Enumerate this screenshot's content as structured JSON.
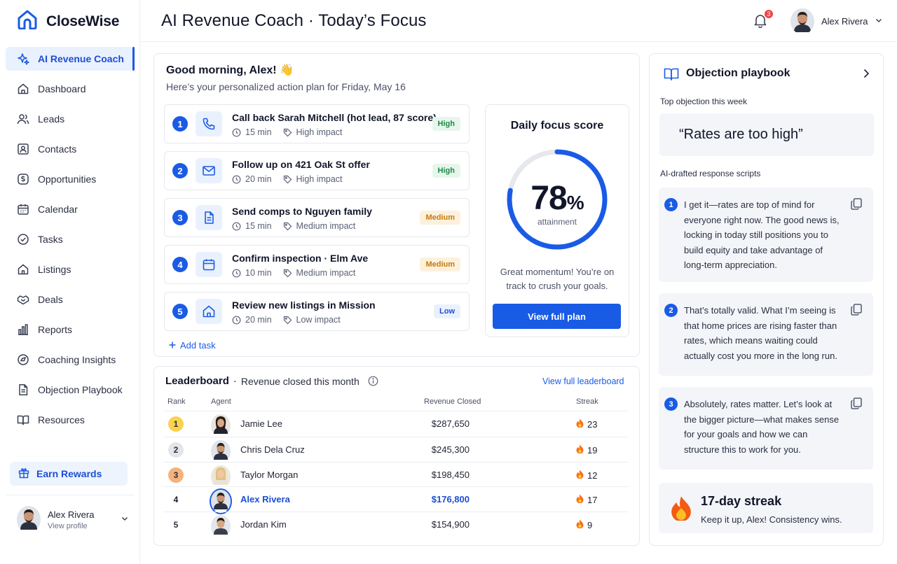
{
  "brand": {
    "name": "CloseWise"
  },
  "sidebar": {
    "items": [
      {
        "label": "AI Revenue Coach",
        "icon": "sparkles-icon"
      },
      {
        "label": "Dashboard",
        "icon": "home-icon"
      },
      {
        "label": "Leads",
        "icon": "users-icon"
      },
      {
        "label": "Contacts",
        "icon": "contact-card-icon"
      },
      {
        "label": "Opportunities",
        "icon": "dollar-icon"
      },
      {
        "label": "Calendar",
        "icon": "calendar-icon"
      },
      {
        "label": "Tasks",
        "icon": "check-circle-icon"
      },
      {
        "label": "Listings",
        "icon": "house-icon"
      },
      {
        "label": "Deals",
        "icon": "handshake-icon"
      },
      {
        "label": "Reports",
        "icon": "bar-chart-icon"
      },
      {
        "label": "Coaching Insights",
        "icon": "compass-icon"
      },
      {
        "label": "Objection Playbook",
        "icon": "document-icon"
      },
      {
        "label": "Resources",
        "icon": "book-icon"
      }
    ],
    "rewards_label": "Earn Rewards",
    "user": {
      "name": "Alex Rivera",
      "sub": "View profile"
    }
  },
  "header": {
    "title": "AI Revenue Coach · Today’s Focus",
    "notification_count": "3",
    "user_name": "Alex Rivera"
  },
  "plan": {
    "greeting": "Good morning, Alex! 👋",
    "subtitle": "Here’s your personalized action plan for Friday, May 16",
    "tasks": [
      {
        "num": "1",
        "title": "Call back Sarah Mitchell (hot lead, 87 score)",
        "time": "15 min",
        "impact": "High impact",
        "priority": "High",
        "icon": "phone-icon"
      },
      {
        "num": "2",
        "title": "Follow up on 421 Oak St offer",
        "time": "20 min",
        "impact": "High impact",
        "priority": "High",
        "icon": "mail-icon"
      },
      {
        "num": "3",
        "title": "Send comps to Nguyen family",
        "time": "15 min",
        "impact": "Medium impact",
        "priority": "Medium",
        "icon": "document-icon"
      },
      {
        "num": "4",
        "title": "Confirm inspection · Elm Ave",
        "time": "10 min",
        "impact": "Medium impact",
        "priority": "Medium",
        "icon": "calendar-icon"
      },
      {
        "num": "5",
        "title": "Review new listings in Mission",
        "time": "20 min",
        "impact": "Low impact",
        "priority": "Low",
        "icon": "house-icon"
      }
    ],
    "add_task": "Add task"
  },
  "focus": {
    "title": "Daily focus score",
    "score": 78,
    "score_text": "78",
    "unit": "%",
    "label": "attainment",
    "message": "Great momentum! You’re on track to crush your goals.",
    "button": "View full plan"
  },
  "leaderboard": {
    "title": "Leaderboard",
    "subtitle": "Revenue closed this month",
    "link": "View full leaderboard",
    "columns": [
      "Rank",
      "Agent",
      "Revenue Closed",
      "Streak"
    ],
    "rows": [
      {
        "rank": "1",
        "agent": "Jamie Lee",
        "revenue": "$287,650",
        "streak": "23"
      },
      {
        "rank": "2",
        "agent": "Chris Dela Cruz",
        "revenue": "$245,300",
        "streak": "19"
      },
      {
        "rank": "3",
        "agent": "Taylor Morgan",
        "revenue": "$198,450",
        "streak": "12"
      },
      {
        "rank": "4",
        "agent": "Alex Rivera",
        "revenue": "$176,800",
        "streak": "17"
      },
      {
        "rank": "5",
        "agent": "Jordan Kim",
        "revenue": "$154,900",
        "streak": "9"
      }
    ]
  },
  "objections": {
    "title": "Objection playbook",
    "top_label": "Top objection this week",
    "quote": "“Rates are too high”",
    "scripts_label": "AI-drafted response scripts",
    "scripts": [
      {
        "num": "1",
        "text": "I get it—rates are top of mind for everyone right now. The good news is, locking in today still positions you to build equity and take advantage of long-term appreciation."
      },
      {
        "num": "2",
        "text": "That’s totally valid. What I’m seeing is that home prices are rising faster than rates, which means waiting could actually cost you more in the long run."
      },
      {
        "num": "3",
        "text": "Absolutely, rates matter. Let’s look at the bigger picture—what makes sense for your goals and how we can structure this to work for you."
      }
    ],
    "streak_title": "17-day streak",
    "streak_sub": "Keep it up, Alex! Consistency wins."
  },
  "colors": {
    "accent": "#1a5be6",
    "high": "#1b8a46",
    "medium": "#c47a10",
    "ring_track": "#e6e8ee"
  }
}
